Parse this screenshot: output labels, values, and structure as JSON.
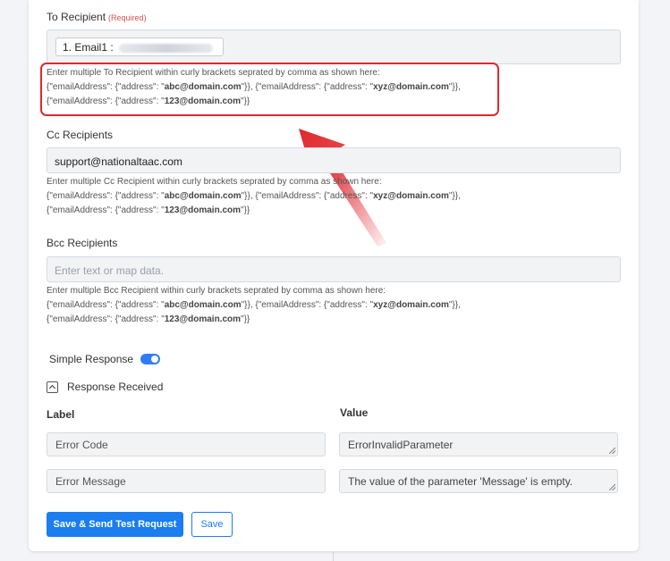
{
  "to": {
    "label": "To Recipient",
    "required": "(Required)",
    "chip": "1. Email1 :",
    "help_line1": "Enter multiple To Recipient within curly brackets seprated by comma as shown here:",
    "help_line2_a": "{\"emailAddress\": {\"address\": \"",
    "help_line2_b": "abc@domain.com",
    "help_line2_c": "\"}}, {\"emailAddress\": {\"address\": \"",
    "help_line2_d": "xyz@domain.com",
    "help_line2_e": "\"}},",
    "help_line3_a": "{\"emailAddress\": {\"address\": \"",
    "help_line3_b": "123@domain.com",
    "help_line3_c": "\"}}"
  },
  "cc": {
    "label": "Cc Recipients",
    "value": "support@nationaltaac.com",
    "help_line1": "Enter multiple Cc Recipient within curly brackets seprated by comma as shown here:",
    "help_line2_a": "{\"emailAddress\": {\"address\": \"",
    "help_line2_b": "abc@domain.com",
    "help_line2_c": "\"}}, {\"emailAddress\": {\"address\": \"",
    "help_line2_d": "xyz@domain.com",
    "help_line2_e": "\"}},",
    "help_line3_a": "{\"emailAddress\": {\"address\": \"",
    "help_line3_b": "123@domain.com",
    "help_line3_c": "\"}}"
  },
  "bcc": {
    "label": "Bcc Recipients",
    "placeholder": "Enter text or map data.",
    "help_line1": "Enter multiple Bcc Recipient within curly brackets seprated by comma as shown here:",
    "help_line2_a": "{\"emailAddress\": {\"address\": \"",
    "help_line2_b": "abc@domain.com",
    "help_line2_c": "\"}}, {\"emailAddress\": {\"address\": \"",
    "help_line2_d": "xyz@domain.com",
    "help_line2_e": "\"}},",
    "help_line3_a": "{\"emailAddress\": {\"address\": \"",
    "help_line3_b": "123@domain.com",
    "help_line3_c": "\"}}"
  },
  "simple_response": {
    "label": "Simple Response",
    "enabled": true
  },
  "response_received": {
    "label": "Response Received"
  },
  "table": {
    "label_header": "Label",
    "value_header": "Value",
    "rows": [
      {
        "label": "Error Code",
        "value": "ErrorInvalidParameter"
      },
      {
        "label": "Error Message",
        "value": "The value of the parameter 'Message' is empty."
      }
    ]
  },
  "buttons": {
    "save_send": "Save & Send Test Request",
    "save": "Save"
  },
  "colors": {
    "accent": "#1a7df0",
    "highlight": "#e0282e",
    "required": "#d9534f"
  }
}
